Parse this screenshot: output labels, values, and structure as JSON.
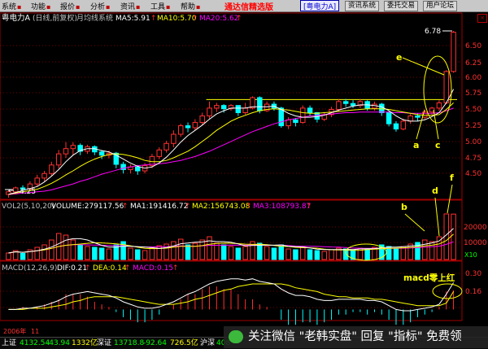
{
  "menubar": {
    "items": [
      "系统",
      "功能",
      "报价",
      "分析",
      "资讯",
      "工具",
      "帮助"
    ],
    "app_title": "通达信精选版",
    "stock_box": "[粤电力A]",
    "buttons": [
      "资讯系统",
      "委托交易",
      "用户论坛"
    ]
  },
  "close_label": "×",
  "price_panel": {
    "stock_name": "粤电力A",
    "period_info": "(日线,前复权)",
    "indicator_name": "月均线系统",
    "ma5": "MA5:5.91",
    "ma10": "MA10:5.70",
    "ma20": "MA20:5.62",
    "max_label": "6.78",
    "min_label": "4.25",
    "y_ticks": [
      "6.50",
      "6.25",
      "6.00",
      "5.75",
      "5.50",
      "5.25",
      "5.00",
      "4.75",
      "4.50"
    ],
    "annotations": [
      "e",
      "a",
      "c"
    ]
  },
  "volume_panel": {
    "name": "VOL2(5,10,20)",
    "volume": "VOLUME:279117.56",
    "ma1": "MA1:191416.72",
    "ma2": "MA2:156743.08",
    "ma3": "MA3:108793.87",
    "y_ticks": [
      "20000",
      "10000"
    ],
    "unit": "X10",
    "annotations": [
      "b",
      "d",
      "f"
    ]
  },
  "macd_panel": {
    "name": "MACD(12,26,9)",
    "dif": "DIF:0.21",
    "dea": "DEA:0.14",
    "macd": "MACD:0.15",
    "y_ticks": [
      "0.30",
      "0.16"
    ],
    "annotation": "macd零上红"
  },
  "axis": {
    "year_label": "2006年",
    "month_label": "11"
  },
  "status": {
    "sh_label": "上证",
    "sh_value": "4132.54",
    "sh_change": "-43.94",
    "sh_amount": "1332亿",
    "sz_label": "深证",
    "sz_value": "13718.8",
    "sz_change": "-92.64",
    "sz_amount": "726.5亿",
    "hs_label": "沪深",
    "hs_value": "408"
  },
  "watermark": "关注微信 \"老韩实盘\" 回复 \"指标\" 免费领",
  "colors": {
    "up": "#ff3030",
    "down": "#00ffff",
    "ma5": "#ffffff",
    "ma10": "#ffff00",
    "ma20": "#ff00ff",
    "grid_red": "#a00000",
    "annotation": "#ffff00"
  },
  "chart_data": {
    "type": "candlestick",
    "price_ylim": [
      4.25,
      6.85
    ],
    "candles": [
      {
        "o": 4.3,
        "c": 4.34,
        "h": 4.36,
        "l": 4.25
      },
      {
        "o": 4.34,
        "c": 4.4,
        "h": 4.42,
        "l": 4.3
      },
      {
        "o": 4.4,
        "c": 4.38,
        "h": 4.44,
        "l": 4.33
      },
      {
        "o": 4.38,
        "c": 4.46,
        "h": 4.5,
        "l": 4.35
      },
      {
        "o": 4.46,
        "c": 4.55,
        "h": 4.6,
        "l": 4.42
      },
      {
        "o": 4.55,
        "c": 4.62,
        "h": 4.66,
        "l": 4.5
      },
      {
        "o": 4.62,
        "c": 4.75,
        "h": 4.8,
        "l": 4.58
      },
      {
        "o": 4.75,
        "c": 4.92,
        "h": 4.98,
        "l": 4.7
      },
      {
        "o": 4.92,
        "c": 5.0,
        "h": 5.1,
        "l": 4.86
      },
      {
        "o": 5.0,
        "c": 5.05,
        "h": 5.1,
        "l": 4.9
      },
      {
        "o": 5.05,
        "c": 4.96,
        "h": 5.08,
        "l": 4.9
      },
      {
        "o": 4.96,
        "c": 5.03,
        "h": 5.06,
        "l": 4.92
      },
      {
        "o": 5.03,
        "c": 4.95,
        "h": 5.05,
        "l": 4.9
      },
      {
        "o": 4.95,
        "c": 4.9,
        "h": 4.98,
        "l": 4.84
      },
      {
        "o": 4.9,
        "c": 4.93,
        "h": 4.97,
        "l": 4.85
      },
      {
        "o": 4.93,
        "c": 4.76,
        "h": 4.95,
        "l": 4.7
      },
      {
        "o": 4.76,
        "c": 4.68,
        "h": 4.8,
        "l": 4.62
      },
      {
        "o": 4.68,
        "c": 4.72,
        "h": 4.76,
        "l": 4.62
      },
      {
        "o": 4.72,
        "c": 4.66,
        "h": 4.75,
        "l": 4.6
      },
      {
        "o": 4.66,
        "c": 4.74,
        "h": 4.78,
        "l": 4.62
      },
      {
        "o": 4.74,
        "c": 4.88,
        "h": 4.92,
        "l": 4.7
      },
      {
        "o": 4.88,
        "c": 4.98,
        "h": 5.02,
        "l": 4.84
      },
      {
        "o": 4.98,
        "c": 5.08,
        "h": 5.12,
        "l": 4.94
      },
      {
        "o": 5.08,
        "c": 5.22,
        "h": 5.28,
        "l": 5.02
      },
      {
        "o": 5.22,
        "c": 5.35,
        "h": 5.38,
        "l": 5.18
      },
      {
        "o": 5.35,
        "c": 5.32,
        "h": 5.4,
        "l": 5.25
      },
      {
        "o": 5.32,
        "c": 5.4,
        "h": 5.45,
        "l": 5.28
      },
      {
        "o": 5.4,
        "c": 5.5,
        "h": 5.55,
        "l": 5.36
      },
      {
        "o": 5.5,
        "c": 5.62,
        "h": 5.72,
        "l": 5.46
      },
      {
        "o": 5.62,
        "c": 5.66,
        "h": 5.7,
        "l": 5.56
      },
      {
        "o": 5.66,
        "c": 5.61,
        "h": 5.68,
        "l": 5.55
      },
      {
        "o": 5.61,
        "c": 5.66,
        "h": 5.68,
        "l": 5.58
      },
      {
        "o": 5.66,
        "c": 5.55,
        "h": 5.66,
        "l": 5.5
      },
      {
        "o": 5.55,
        "c": 5.62,
        "h": 5.7,
        "l": 5.52
      },
      {
        "o": 5.62,
        "c": 5.78,
        "h": 5.8,
        "l": 5.6
      },
      {
        "o": 5.78,
        "c": 5.58,
        "h": 5.8,
        "l": 5.54
      },
      {
        "o": 5.58,
        "c": 5.68,
        "h": 5.72,
        "l": 5.56
      },
      {
        "o": 5.68,
        "c": 5.62,
        "h": 5.72,
        "l": 5.58
      },
      {
        "o": 5.62,
        "c": 5.35,
        "h": 5.64,
        "l": 5.32
      },
      {
        "o": 5.35,
        "c": 5.44,
        "h": 5.48,
        "l": 5.3
      },
      {
        "o": 5.44,
        "c": 5.4,
        "h": 5.47,
        "l": 5.34
      },
      {
        "o": 5.4,
        "c": 5.62,
        "h": 5.66,
        "l": 5.38
      },
      {
        "o": 5.62,
        "c": 5.55,
        "h": 5.66,
        "l": 5.5
      },
      {
        "o": 5.55,
        "c": 5.45,
        "h": 5.56,
        "l": 5.4
      },
      {
        "o": 5.45,
        "c": 5.52,
        "h": 5.56,
        "l": 5.42
      },
      {
        "o": 5.52,
        "c": 5.6,
        "h": 5.64,
        "l": 5.48
      },
      {
        "o": 5.6,
        "c": 5.72,
        "h": 5.76,
        "l": 5.56
      },
      {
        "o": 5.72,
        "c": 5.69,
        "h": 5.76,
        "l": 5.64
      },
      {
        "o": 5.69,
        "c": 5.66,
        "h": 5.74,
        "l": 5.62
      },
      {
        "o": 5.66,
        "c": 5.72,
        "h": 5.76,
        "l": 5.62
      },
      {
        "o": 5.72,
        "c": 5.62,
        "h": 5.74,
        "l": 5.58
      },
      {
        "o": 5.62,
        "c": 5.68,
        "h": 5.72,
        "l": 5.58
      },
      {
        "o": 5.68,
        "c": 5.55,
        "h": 5.7,
        "l": 5.5
      },
      {
        "o": 5.55,
        "c": 5.38,
        "h": 5.58,
        "l": 5.34
      },
      {
        "o": 5.38,
        "c": 5.3,
        "h": 5.42,
        "l": 5.26
      },
      {
        "o": 5.3,
        "c": 5.42,
        "h": 5.46,
        "l": 5.28
      },
      {
        "o": 5.42,
        "c": 5.5,
        "h": 5.53,
        "l": 5.38
      },
      {
        "o": 5.5,
        "c": 5.48,
        "h": 5.54,
        "l": 5.42
      },
      {
        "o": 5.48,
        "c": 5.56,
        "h": 5.6,
        "l": 5.45
      },
      {
        "o": 5.56,
        "c": 5.62,
        "h": 5.64,
        "l": 5.5
      },
      {
        "o": 5.62,
        "c": 5.7,
        "h": 5.74,
        "l": 5.58
      },
      {
        "o": 5.7,
        "c": 6.18,
        "h": 6.2,
        "l": 5.68
      },
      {
        "o": 6.18,
        "c": 6.78,
        "h": 6.8,
        "l": 6.16
      }
    ],
    "ma5": [
      4.3,
      4.33,
      4.36,
      4.39,
      4.42,
      4.49,
      4.58,
      4.68,
      4.8,
      4.9,
      4.97,
      5.0,
      5.0,
      4.97,
      4.95,
      4.9,
      4.84,
      4.78,
      4.73,
      4.7,
      4.72,
      4.78,
      4.87,
      4.98,
      5.1,
      5.2,
      5.28,
      5.36,
      5.45,
      5.53,
      5.58,
      5.62,
      5.62,
      5.62,
      5.64,
      5.64,
      5.64,
      5.65,
      5.6,
      5.54,
      5.5,
      5.48,
      5.48,
      5.49,
      5.51,
      5.55,
      5.59,
      5.62,
      5.65,
      5.67,
      5.67,
      5.66,
      5.64,
      5.58,
      5.5,
      5.44,
      5.42,
      5.42,
      5.44,
      5.49,
      5.55,
      5.7,
      5.91
    ],
    "ma10": [
      4.3,
      4.32,
      4.34,
      4.36,
      4.38,
      4.42,
      4.47,
      4.53,
      4.6,
      4.66,
      4.73,
      4.79,
      4.84,
      4.88,
      4.91,
      4.92,
      4.91,
      4.89,
      4.86,
      4.82,
      4.8,
      4.8,
      4.82,
      4.86,
      4.91,
      4.96,
      5.03,
      5.11,
      5.19,
      5.28,
      5.35,
      5.42,
      5.47,
      5.51,
      5.55,
      5.58,
      5.6,
      5.61,
      5.6,
      5.59,
      5.57,
      5.55,
      5.54,
      5.54,
      5.55,
      5.56,
      5.57,
      5.58,
      5.59,
      5.6,
      5.61,
      5.61,
      5.61,
      5.6,
      5.58,
      5.56,
      5.54,
      5.52,
      5.51,
      5.51,
      5.52,
      5.6,
      5.7
    ],
    "ma20": [
      4.3,
      4.31,
      4.32,
      4.33,
      4.34,
      4.35,
      4.37,
      4.4,
      4.43,
      4.46,
      4.5,
      4.53,
      4.57,
      4.61,
      4.64,
      4.67,
      4.7,
      4.72,
      4.74,
      4.75,
      4.76,
      4.77,
      4.78,
      4.8,
      4.82,
      4.85,
      4.88,
      4.92,
      4.96,
      5.01,
      5.06,
      5.11,
      5.16,
      5.21,
      5.26,
      5.3,
      5.34,
      5.38,
      5.41,
      5.44,
      5.46,
      5.48,
      5.5,
      5.51,
      5.52,
      5.53,
      5.54,
      5.55,
      5.55,
      5.56,
      5.56,
      5.56,
      5.56,
      5.56,
      5.55,
      5.55,
      5.54,
      5.54,
      5.54,
      5.54,
      5.55,
      5.58,
      5.62
    ],
    "resistance_level": 5.75,
    "volume_ylim": [
      0,
      30000
    ],
    "volume": [
      4000,
      5500,
      3800,
      6000,
      7500,
      9000,
      12000,
      16000,
      15000,
      12000,
      9000,
      8000,
      7500,
      7000,
      6500,
      9000,
      11000,
      7000,
      6000,
      5500,
      7000,
      8500,
      9500,
      11000,
      12500,
      9000,
      10000,
      12000,
      14000,
      10000,
      9000,
      8000,
      7000,
      8000,
      11000,
      10000,
      8000,
      7000,
      9000,
      6500,
      6000,
      8000,
      6000,
      5500,
      5000,
      6000,
      7000,
      6500,
      6000,
      7000,
      6500,
      7500,
      9000,
      8000,
      7000,
      8000,
      9500,
      10500,
      12000,
      11000,
      14000,
      28000,
      27912
    ],
    "vol_ma1": [
      4000,
      4750,
      4430,
      4830,
      5360,
      6360,
      7660,
      9700,
      11900,
      12800,
      12800,
      12000,
      10300,
      8700,
      7600,
      7600,
      8200,
      8100,
      7900,
      7700,
      7300,
      6800,
      7300,
      8300,
      9700,
      10100,
      10600,
      10800,
      11500,
      11000,
      11000,
      10600,
      9600,
      8400,
      8600,
      8800,
      8800,
      8800,
      9000,
      8100,
      7900,
      7700,
      7100,
      6400,
      6100,
      6100,
      6100,
      6200,
      6100,
      6500,
      6600,
      6700,
      7200,
      7600,
      7600,
      7900,
      8300,
      8600,
      9400,
      10200,
      11400,
      15100,
      19142
    ],
    "vol_ma2": [
      4000,
      4750,
      4430,
      4830,
      5360,
      5970,
      6830,
      7980,
      8760,
      9080,
      9490,
      9960,
      10310,
      10210,
      9950,
      9630,
      9220,
      8470,
      7550,
      6920,
      6700,
      6750,
      7000,
      7550,
      8150,
      8150,
      8050,
      8550,
      9400,
      9850,
      10050,
      10000,
      9750,
      9450,
      9300,
      9350,
      9150,
      8650,
      8150,
      8000,
      7500,
      7300,
      7200,
      6950,
      6350,
      6000,
      5900,
      5900,
      5600,
      5700,
      6150,
      6350,
      6650,
      6900,
      7000,
      7200,
      7450,
      7800,
      8400,
      8800,
      9550,
      11650,
      15674
    ],
    "vol_ma3": [
      4000,
      4750,
      4430,
      4830,
      5360,
      5970,
      6830,
      7980,
      8760,
      9080,
      9080,
      8990,
      8880,
      8760,
      8630,
      8540,
      8490,
      8250,
      7920,
      7580,
      7750,
      7830,
      7880,
      8100,
      8380,
      8270,
      8200,
      8400,
      8730,
      8730,
      8800,
      8870,
      8820,
      8850,
      8930,
      9010,
      8870,
      8750,
      8770,
      8550,
      8250,
      8150,
      8100,
      8050,
      7850,
      7700,
      7650,
      7350,
      7030,
      6850,
      6830,
      6830,
      6920,
      6940,
      6870,
      6970,
      7130,
      7280,
      7640,
      7860,
      8210,
      9320,
      10879
    ],
    "macd_ylim": [
      -0.08,
      0.34
    ],
    "dif": [
      0.0,
      0.0,
      0.01,
      0.01,
      0.02,
      0.03,
      0.05,
      0.07,
      0.1,
      0.12,
      0.13,
      0.14,
      0.13,
      0.12,
      0.11,
      0.09,
      0.06,
      0.04,
      0.02,
      0.01,
      0.01,
      0.02,
      0.04,
      0.06,
      0.09,
      0.12,
      0.14,
      0.17,
      0.2,
      0.22,
      0.23,
      0.24,
      0.24,
      0.23,
      0.24,
      0.22,
      0.21,
      0.2,
      0.16,
      0.13,
      0.11,
      0.11,
      0.1,
      0.08,
      0.07,
      0.07,
      0.08,
      0.08,
      0.08,
      0.08,
      0.07,
      0.07,
      0.06,
      0.03,
      0.0,
      -0.01,
      -0.01,
      0.0,
      0.01,
      0.02,
      0.04,
      0.12,
      0.21
    ],
    "dea": [
      0.0,
      0.0,
      0.0,
      0.01,
      0.01,
      0.01,
      0.02,
      0.03,
      0.04,
      0.06,
      0.07,
      0.09,
      0.1,
      0.1,
      0.1,
      0.1,
      0.09,
      0.08,
      0.07,
      0.06,
      0.05,
      0.04,
      0.04,
      0.04,
      0.05,
      0.06,
      0.08,
      0.09,
      0.11,
      0.13,
      0.15,
      0.16,
      0.18,
      0.19,
      0.2,
      0.2,
      0.2,
      0.2,
      0.2,
      0.19,
      0.17,
      0.16,
      0.15,
      0.14,
      0.12,
      0.11,
      0.1,
      0.1,
      0.09,
      0.09,
      0.09,
      0.08,
      0.08,
      0.07,
      0.06,
      0.05,
      0.04,
      0.03,
      0.03,
      0.03,
      0.03,
      0.05,
      0.14
    ],
    "macd_hist": [
      0.0,
      0.0,
      0.02,
      0.0,
      0.02,
      0.04,
      0.06,
      0.08,
      0.12,
      0.12,
      0.12,
      0.1,
      0.06,
      0.04,
      0.02,
      -0.02,
      -0.06,
      -0.08,
      -0.1,
      -0.1,
      -0.08,
      -0.04,
      0.0,
      0.04,
      0.08,
      0.12,
      0.12,
      0.16,
      0.18,
      0.18,
      0.16,
      0.16,
      0.12,
      0.08,
      0.08,
      0.04,
      0.02,
      0.0,
      -0.08,
      -0.12,
      -0.12,
      -0.1,
      -0.1,
      -0.12,
      -0.1,
      -0.08,
      -0.04,
      -0.04,
      -0.02,
      -0.02,
      -0.04,
      -0.02,
      -0.04,
      -0.08,
      -0.12,
      -0.12,
      -0.1,
      -0.06,
      -0.04,
      -0.02,
      0.02,
      0.14,
      0.15
    ]
  }
}
